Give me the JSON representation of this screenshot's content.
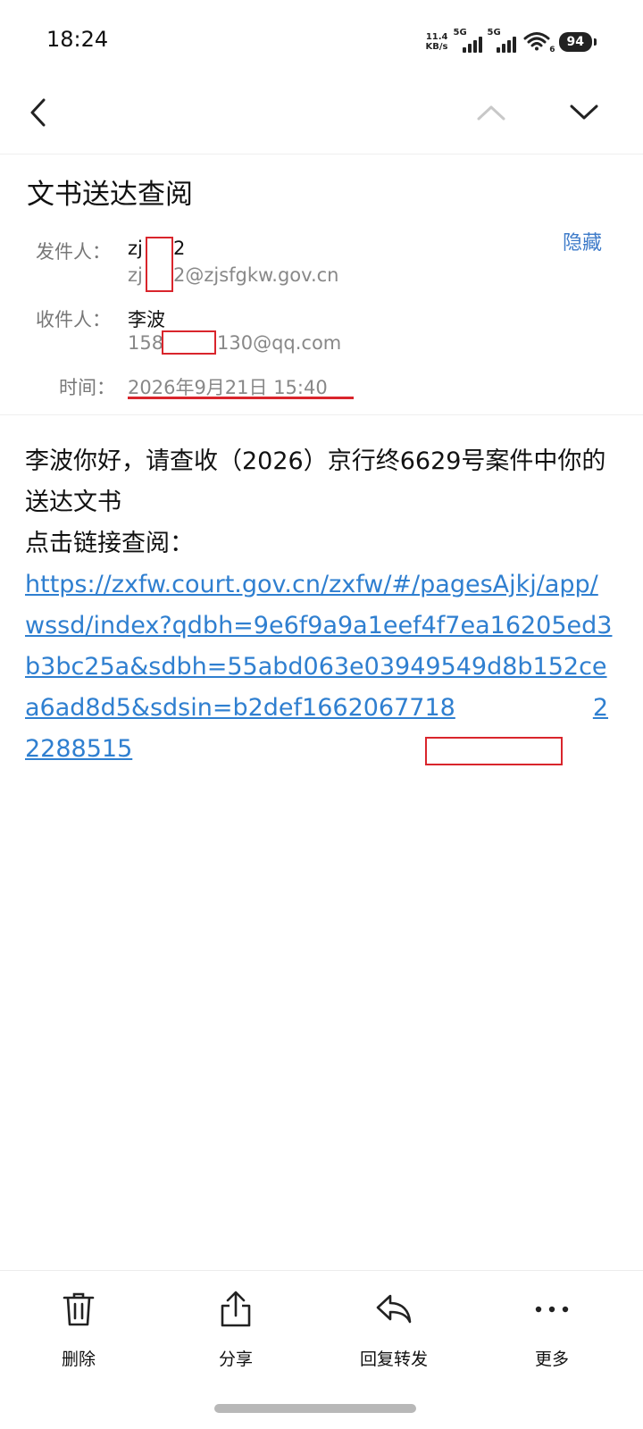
{
  "status": {
    "time": "18:24",
    "net_speed_value": "11.4",
    "net_speed_unit": "KB/s",
    "signal1_label": "5G",
    "signal2_label": "5G",
    "wifi_sub": "6",
    "battery": "94"
  },
  "nav": {
    "back_icon": "chevron-left-icon",
    "prev_icon": "chevron-up-icon",
    "next_icon": "chevron-down-icon"
  },
  "email": {
    "subject": "文书送达查阅",
    "hide_label": "隐藏",
    "from_label": "发件人：",
    "from_name_a": "zj",
    "from_name_b": "2",
    "from_email_a": "zj",
    "from_email_b": "2@zjsfgkw.gov.cn",
    "to_label": "收件人：",
    "to_name": "李波",
    "to_email_a": "158",
    "to_email_b": "130@qq.com",
    "time_label": "时间：",
    "time_value": "2026年9月21日 15:40",
    "body_line1": "李波你好，请查收（2026）京行终6629号案件中你的送达文书",
    "body_line2": "点击链接查阅：",
    "link_a": "https://zxfw.court.gov.cn/zxfw/#/pagesAjkj/app/wssd/index?qdbh=9e6f9a9a1eef4f7ea16205ed3b3bc25a&sdbh=55abd063e03949549d8b152cea6ad8d5&sdsin=b2def1662067718",
    "link_b": "22288515"
  },
  "toolbar": {
    "delete_label": "删除",
    "share_label": "分享",
    "reply_forward_label": "回复转发",
    "more_label": "更多"
  },
  "colors": {
    "link": "#2f7fd0",
    "accent": "#3e7bc9",
    "redaction": "#d9252c"
  }
}
